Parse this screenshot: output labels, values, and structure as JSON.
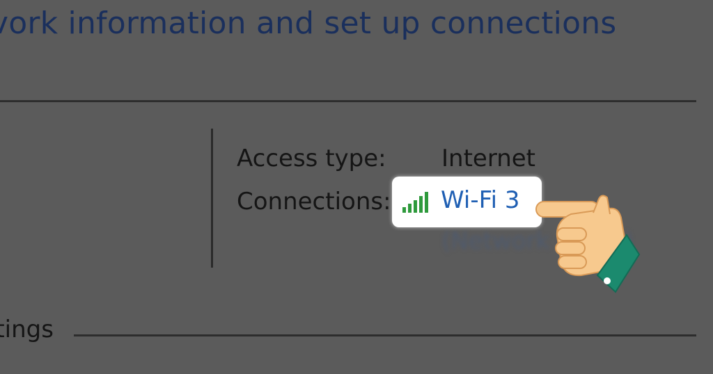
{
  "header": {
    "title": "vork information and set up connections"
  },
  "network_panel": {
    "access_type_label": "Access type:",
    "access_type_value": "Internet",
    "connections_label": "Connections:",
    "connection_name": "Wi-Fi 3",
    "blurred_text": "(Network name)"
  },
  "section": {
    "label": "ttings"
  },
  "icons": {
    "wifi": "wifi-signal-bars-icon",
    "pointer": "hand-pointer-icon"
  },
  "colors": {
    "title": "#1a2f5c",
    "link": "#1f5fb3",
    "signal": "#2e9a3c",
    "hand_skin": "#f7c98e",
    "cuff": "#1b8a6e"
  }
}
